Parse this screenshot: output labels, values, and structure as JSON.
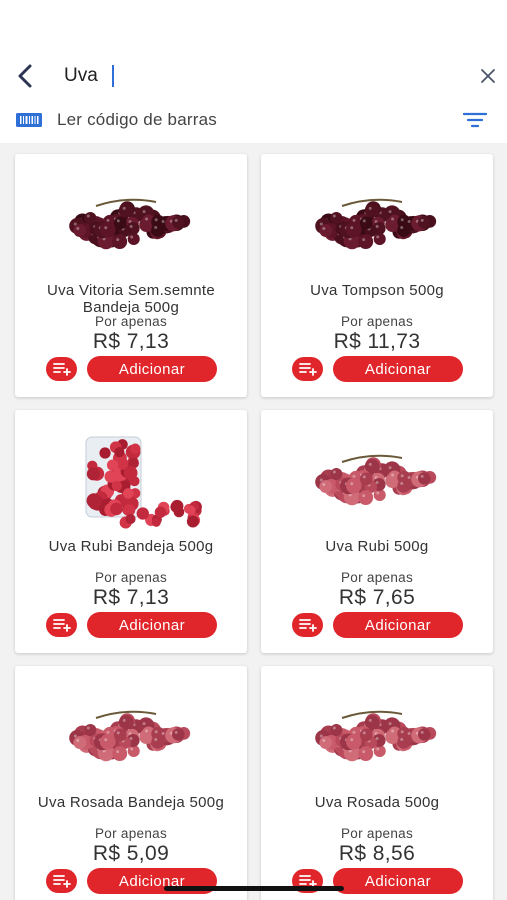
{
  "search": {
    "value": "Uva",
    "placeholder": ""
  },
  "barcode": {
    "label": "Ler código de barras"
  },
  "colors": {
    "accent": "#e0262b",
    "icon_blue": "#2f6fd8",
    "back": "#2d3554"
  },
  "icons": {
    "back": "chevron-left-icon",
    "clear": "close-icon",
    "barcode": "barcode-icon",
    "filter": "filter-icon",
    "list": "add-to-list-icon"
  },
  "products": [
    {
      "name": "Uva Vitoria Sem.semnte Bandeja 500g",
      "price_prefix": "Por apenas",
      "price": "R$ 7,13",
      "add_label": "Adicionar",
      "image": "dark-grapes"
    },
    {
      "name": "Uva Tompson 500g",
      "price_prefix": "Por apenas",
      "price": "R$ 11,73",
      "add_label": "Adicionar",
      "image": "dark-grapes"
    },
    {
      "name": "Uva Rubi Bandeja 500g",
      "price_prefix": "Por apenas",
      "price": "R$ 7,13",
      "add_label": "Adicionar",
      "image": "rubi-tray"
    },
    {
      "name": "Uva Rubi 500g",
      "price_prefix": "Por apenas",
      "price": "R$ 7,65",
      "add_label": "Adicionar",
      "image": "pink-grapes"
    },
    {
      "name": "Uva Rosada Bandeja 500g",
      "price_prefix": "Por apenas",
      "price": "R$ 5,09",
      "add_label": "Adicionar",
      "image": "pink-grapes"
    },
    {
      "name": "Uva Rosada 500g",
      "price_prefix": "Por apenas",
      "price": "R$ 8,56",
      "add_label": "Adicionar",
      "image": "pink-grapes"
    }
  ]
}
